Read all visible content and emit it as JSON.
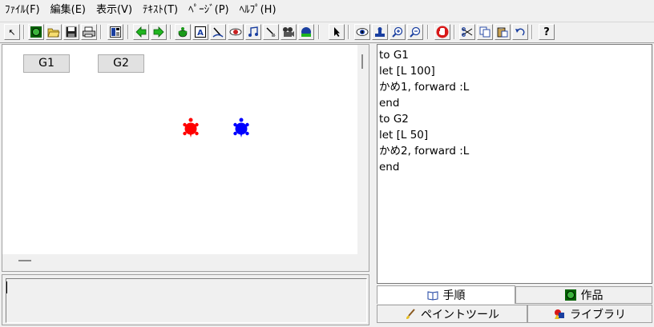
{
  "menu": {
    "items": [
      {
        "label": "ﾌｧｲﾙ(F)"
      },
      {
        "label": "編集(E)"
      },
      {
        "label": "表示(V)"
      },
      {
        "label": "ﾃｷｽﾄ(T)"
      },
      {
        "label": "ﾍﾟｰｼﾞ(P)"
      },
      {
        "label": "ﾍﾙﾌﾟ(H)"
      }
    ]
  },
  "toolbar": {
    "buttons": [
      {
        "icon": "pointer-icon",
        "glyph": "↖"
      },
      {
        "icon": "new-icon",
        "glyph": "●"
      },
      {
        "icon": "open-folder-icon",
        "glyph": "📂"
      },
      {
        "icon": "save-icon",
        "glyph": "■"
      },
      {
        "icon": "print-icon",
        "glyph": "▤"
      },
      {
        "icon": "layout-icon",
        "glyph": "▥"
      },
      {
        "icon": "back-arrow-icon",
        "glyph": "◀"
      },
      {
        "icon": "forward-arrow-icon",
        "glyph": "▶"
      },
      {
        "icon": "turtle-icon",
        "glyph": "✿"
      },
      {
        "icon": "text-box-icon",
        "glyph": "A"
      },
      {
        "icon": "drawing-icon",
        "glyph": "✎"
      },
      {
        "icon": "image-icon",
        "glyph": "◉"
      },
      {
        "icon": "music-icon",
        "glyph": "♫"
      },
      {
        "icon": "slider-icon",
        "glyph": "⟋"
      },
      {
        "icon": "movie-icon",
        "glyph": "▣"
      },
      {
        "icon": "globe-icon",
        "glyph": "◍"
      },
      {
        "icon": "select-arrow-icon",
        "glyph": "➤"
      },
      {
        "icon": "eye-icon",
        "glyph": "◉"
      },
      {
        "icon": "stamp-icon",
        "glyph": "♟"
      },
      {
        "icon": "zoom-in-icon",
        "glyph": "⊕"
      },
      {
        "icon": "zoom-out-icon",
        "glyph": "⊖"
      },
      {
        "icon": "stop-hand-icon",
        "glyph": "✋"
      },
      {
        "icon": "cut-icon",
        "glyph": "✂"
      },
      {
        "icon": "copy-icon",
        "glyph": "❐"
      },
      {
        "icon": "paste-icon",
        "glyph": "📋"
      },
      {
        "icon": "undo-icon",
        "glyph": "↶"
      },
      {
        "icon": "help-icon",
        "glyph": "?"
      }
    ]
  },
  "canvas": {
    "buttons": [
      {
        "label": "G1"
      },
      {
        "label": "G2"
      }
    ],
    "turtles": [
      {
        "name": "かめ1",
        "color": "#ff0000"
      },
      {
        "name": "かめ2",
        "color": "#0000ff"
      }
    ]
  },
  "editor": {
    "lines": [
      "to G1",
      "let [L 100]",
      "かめ1, forward :L",
      "end",
      "to G2",
      "let [L 50]",
      "かめ2, forward :L",
      "end"
    ]
  },
  "tabs": {
    "procedure": "手順",
    "work": "作品",
    "paint_tool": "ペイントツール",
    "library": "ライブラリ"
  },
  "command": {
    "value": ""
  }
}
